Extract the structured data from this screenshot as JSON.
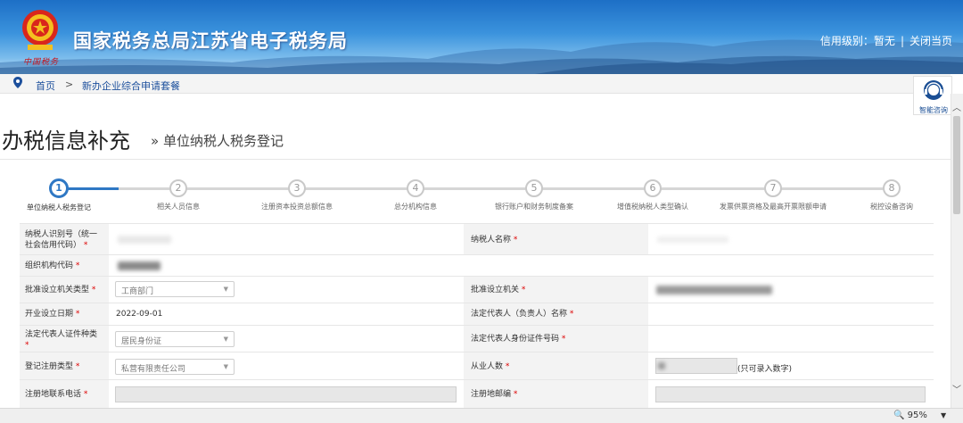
{
  "header": {
    "site_title": "国家税务总局江苏省电子税务局",
    "brand_sign": "中国税务",
    "credit_label": "信用级别：暂无",
    "close_link": "关闭当页",
    "separator": "|"
  },
  "breadcrumb": {
    "home": "首页",
    "separator": ">",
    "current": "新办企业综合申请套餐"
  },
  "consult": {
    "label": "智能咨询"
  },
  "page": {
    "title": "办税信息补充",
    "subtitle": "» 单位纳税人税务登记"
  },
  "steps": [
    {
      "num": "1",
      "label": "单位纳税人税务登记",
      "active": true
    },
    {
      "num": "2",
      "label": "相关人员信息"
    },
    {
      "num": "3",
      "label": "注册资本投资总额信息"
    },
    {
      "num": "4",
      "label": "总分机构信息"
    },
    {
      "num": "5",
      "label": "银行账户和财务制度备案"
    },
    {
      "num": "6",
      "label": "增值税纳税人类型确认"
    },
    {
      "num": "7",
      "label": "发票供票资格及最高开票限额申请"
    },
    {
      "num": "8",
      "label": "税控设备咨询"
    }
  ],
  "form": {
    "taxpayer_id_label_1": "纳税人识别号（统一",
    "taxpayer_id_label_2": "社会信用代码）",
    "taxpayer_name_label": "纳税人名称",
    "org_code_label": "组织机构代码",
    "approval_type_label": "批准设立机关类型",
    "approval_type_value": "工商部门",
    "approval_org_label": "批准设立机关",
    "open_date_label": "开业设立日期",
    "open_date_value": "2022-09-01",
    "legal_rep_name_label": "法定代表人（负责人）名称",
    "legal_rep_idtype_label_1": "法定代表人证件种类",
    "legal_rep_idtype_value": "居民身份证",
    "legal_rep_idno_label": "法定代表人身份证件号码",
    "reg_type_label": "登记注册类型",
    "reg_type_value": "私营有限责任公司",
    "employees_label": "从业人数",
    "employees_hint": "(只可录入数字)",
    "reg_phone_label": "注册地联系电话",
    "reg_zip_label": "注册地邮编",
    "required_mark": "*"
  },
  "statusbar": {
    "zoom": "95%",
    "zoom_arrow": "▼"
  },
  "colors": {
    "accent": "#2f78c4",
    "banner": "#1d6fc6",
    "link": "#1c4f9c",
    "required": "#dd0000"
  }
}
